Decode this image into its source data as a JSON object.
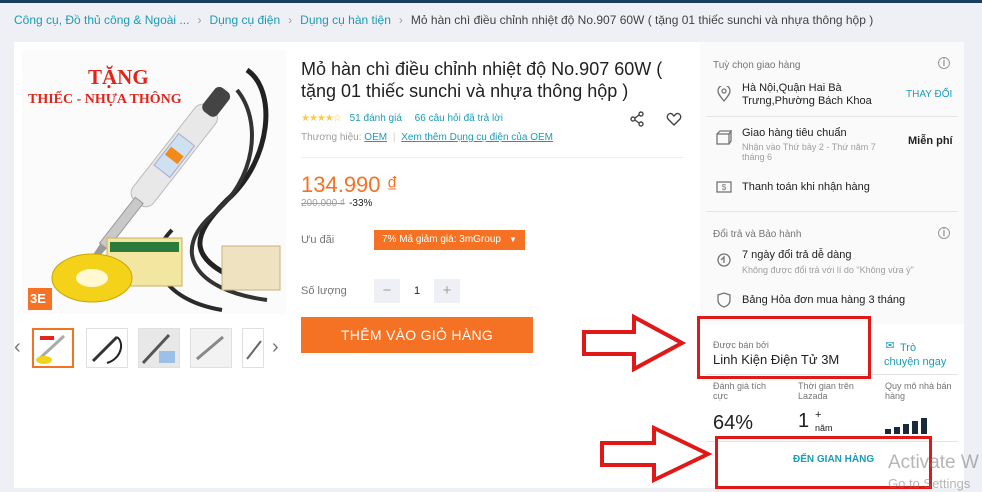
{
  "breadcrumb": {
    "items": [
      "Công cụ, Đồ thủ công & Ngoài ...",
      "Dụng cụ điện",
      "Dụng cụ hàn tiện"
    ],
    "current": "Mỏ hàn chì điều chỉnh nhiệt độ No.907 60W ( tặng 01 thiếc sunchi và nhựa thông hộp )"
  },
  "gallery": {
    "banner_line1": "TẶNG",
    "banner_line2": "THIẾC - NHỰA THÔNG",
    "logo": "3E",
    "thumb_count": 5,
    "prev_icon": "chevron-left-icon",
    "next_icon": "chevron-right-icon"
  },
  "product": {
    "title": "Mỏ hàn chì điều chỉnh nhiệt độ No.907 60W ( tặng 01 thiếc sunchi và nhựa thông hộp )",
    "stars": "★★★★☆",
    "reviews": "51 đánh giá",
    "questions": "66 câu hỏi đã trả lời",
    "brand_label": "Thương hiệu:",
    "brand": "OEM",
    "more_link": "Xem thêm Dụng cụ điện của OEM",
    "price": "134.990 ₫",
    "old_price": "200.000 ₫",
    "discount": "-33%",
    "promo_label": "Ưu đãi",
    "voucher": "7% Mã giảm giá: 3mGroup",
    "qty_label": "Số lượng",
    "qty": "1",
    "minus": "−",
    "plus": "+",
    "cart_button": "THÊM VÀO GIỎ HÀNG"
  },
  "delivery": {
    "section_title": "Tuỳ chọn giao hàng",
    "address": "Hà Nội,Quận Hai Bà Trưng,Phường Bách Khoa",
    "change": "THAY ĐỔI",
    "standard": "Giao hàng tiêu chuẩn",
    "standard_note": "Nhận vào Thứ bảy 2 - Thứ năm 7 tháng 6",
    "standard_fee": "Miễn phí",
    "cod": "Thanh toán khi nhận hàng"
  },
  "returns": {
    "section_title": "Đổi trả và Bảo hành",
    "return_days": "7 ngày đổi trả dễ dàng",
    "return_note": "Không được đổi trả với lí do \"Không vừa ý\"",
    "warranty": "Bảng Hỏa đơn mua hàng 3 tháng"
  },
  "seller": {
    "sold_by_label": "Được bán bởi",
    "name": "Linh Kiện Điện Tử 3M",
    "chat": "Trò chuyện ngay",
    "positive_label": "Đánh giá tích cực",
    "positive_value": "64%",
    "time_label": "Thời gian trên Lazada",
    "time_value": "1",
    "time_plus": "+",
    "time_unit": "năm",
    "scale_label": "Quy mô nhà bán hàng",
    "visit_store": "ĐẾN GIAN HÀNG"
  },
  "watermark": {
    "line1": "Activate W",
    "line2": "Go to Settings"
  },
  "colors": {
    "accent": "#f57224",
    "link": "#1a9cb7",
    "annotation": "#e01818"
  }
}
